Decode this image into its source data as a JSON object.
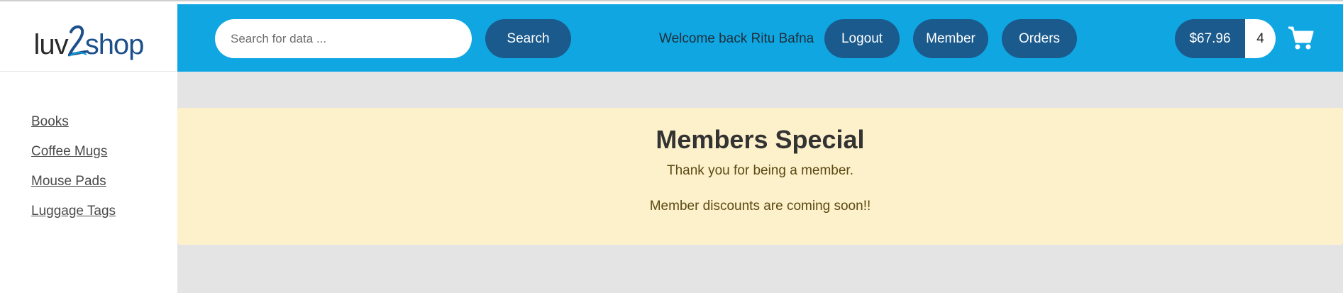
{
  "brand": {
    "logo_part1": "luv",
    "logo_part2": "shop",
    "accent": "#0fa6e2",
    "button_color": "#1b5a8d"
  },
  "sidebar": {
    "items": [
      {
        "label": "Books"
      },
      {
        "label": "Coffee Mugs"
      },
      {
        "label": "Mouse Pads"
      },
      {
        "label": "Luggage Tags"
      }
    ]
  },
  "header": {
    "search": {
      "placeholder": "Search for data ...",
      "value": ""
    },
    "search_label": "Search",
    "welcome_text": "Welcome back Ritu Bafna",
    "logout_label": "Logout",
    "member_label": "Member",
    "orders_label": "Orders",
    "cart": {
      "total": "$67.96",
      "quantity": "4",
      "icon": "shopping-cart-icon"
    }
  },
  "main": {
    "banner": {
      "title": "Members Special",
      "line1": "Thank you for being a member.",
      "line2": "Member discounts are coming soon!!",
      "background": "#fdf1cb"
    }
  }
}
